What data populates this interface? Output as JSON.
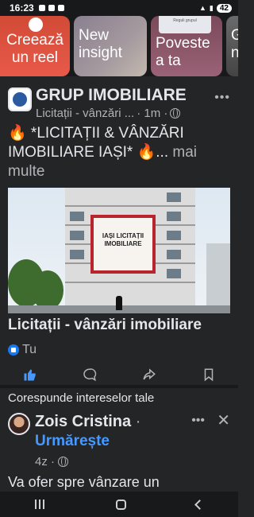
{
  "status_bar": {
    "time": "16:23",
    "battery": "42"
  },
  "stories": {
    "create_label": "Creează un reel",
    "insight_label": "New insight",
    "poveste_label": "Poveste a ta",
    "poveste_mini": "Reguli grupul",
    "cut_label": "G n"
  },
  "post": {
    "page_name": "GRUP IMOBILIARE",
    "page_sub": "Licitații - vânzări ...",
    "time": "· 1m ·",
    "text": "🔥 *LICITAȚII & VÂNZĂRI IMOBILIARE IAȘI* 🔥...",
    "more": "mai multe",
    "banner_text": "IAȘI LICITAȚII IMOBILIARE",
    "link_title": "Licitații - vânzări imobiliare",
    "reactor": "Tu"
  },
  "suggestion": {
    "header": "Corespunde intereselor tale",
    "user_name": "Zois Cristina",
    "follow_label": "Urmărește",
    "time": "4z ·",
    "text_start": "Va ofer spre vânzare un"
  },
  "colors": {
    "accent": "#1877f2",
    "follow": "#4599ff",
    "background": "#242526"
  },
  "icons": [
    "like-icon",
    "comment-icon",
    "share-icon",
    "save-icon",
    "globe-icon",
    "close-icon",
    "more-icon"
  ]
}
